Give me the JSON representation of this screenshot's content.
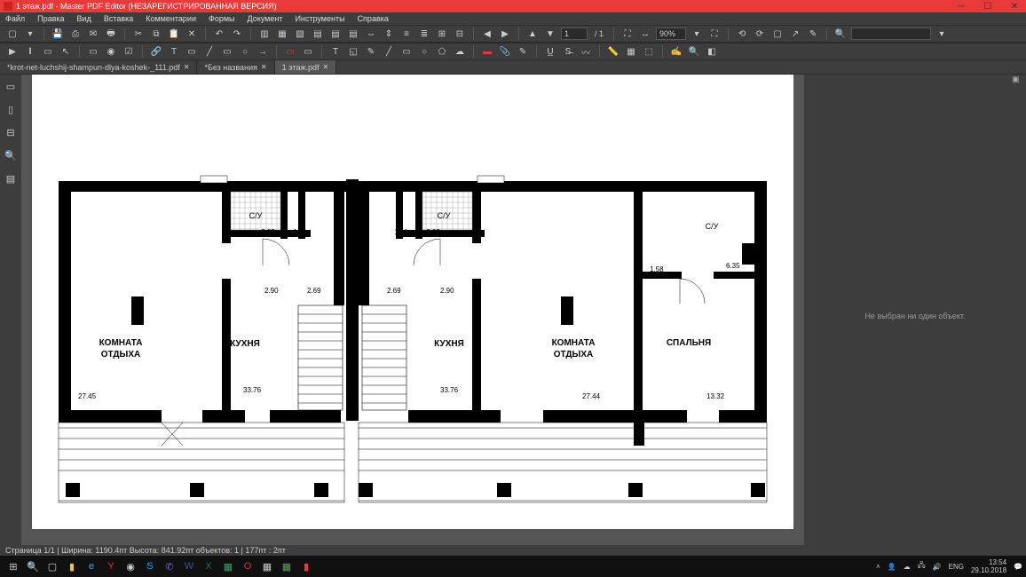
{
  "title": "1 этаж.pdf - Master PDF Editor (НЕЗАРЕГИСТРИРОВАННАЯ ВЕРСИЯ)",
  "menu": [
    "Файл",
    "Правка",
    "Вид",
    "Вставка",
    "Комментарии",
    "Формы",
    "Документ",
    "Инструменты",
    "Справка"
  ],
  "page": {
    "current": "1",
    "total": "/ 1",
    "zoom": "90%"
  },
  "tabs": [
    {
      "label": "*krot-net-luchshij-shampun-dlya-koshek-_111.pdf",
      "active": false
    },
    {
      "label": "*Без названия",
      "active": false
    },
    {
      "label": "1 этаж.pdf",
      "active": true
    }
  ],
  "props": {
    "empty": "Не выбран ни один объект."
  },
  "status": "Страница 1/1 | Ширина: 1190.4пт Высота: 841.92пт объектов: 1  |  177пт : 2пт",
  "tray": {
    "lang": "ENG",
    "time": "13:54",
    "date": "29.10.2018"
  },
  "plan": {
    "rooms": {
      "rest1": {
        "label1": "КОМНАТА",
        "label2": "ОТДЫХА",
        "area": "27.45"
      },
      "kitchen1": {
        "label": "КУХНЯ",
        "area": "33.76",
        "d1": "2.90",
        "d2": "2.69"
      },
      "bath1": {
        "label": "С/У",
        "d1": "2.02",
        "d2": "1.51"
      },
      "kitchen2": {
        "label": "КУХНЯ",
        "area": "33.76",
        "d1": "2.69",
        "d2": "2.90"
      },
      "bath2": {
        "label": "С/У",
        "d1": "1.51",
        "d2": "2.02"
      },
      "rest2": {
        "label1": "КОМНАТА",
        "label2": "ОТДЫХА",
        "area": "27.44"
      },
      "bedroom": {
        "label": "СПАЛЬНЯ",
        "area": "13.32"
      },
      "bath3": {
        "label": "С/У",
        "d1": "1.58",
        "d2": "6.35"
      }
    }
  }
}
